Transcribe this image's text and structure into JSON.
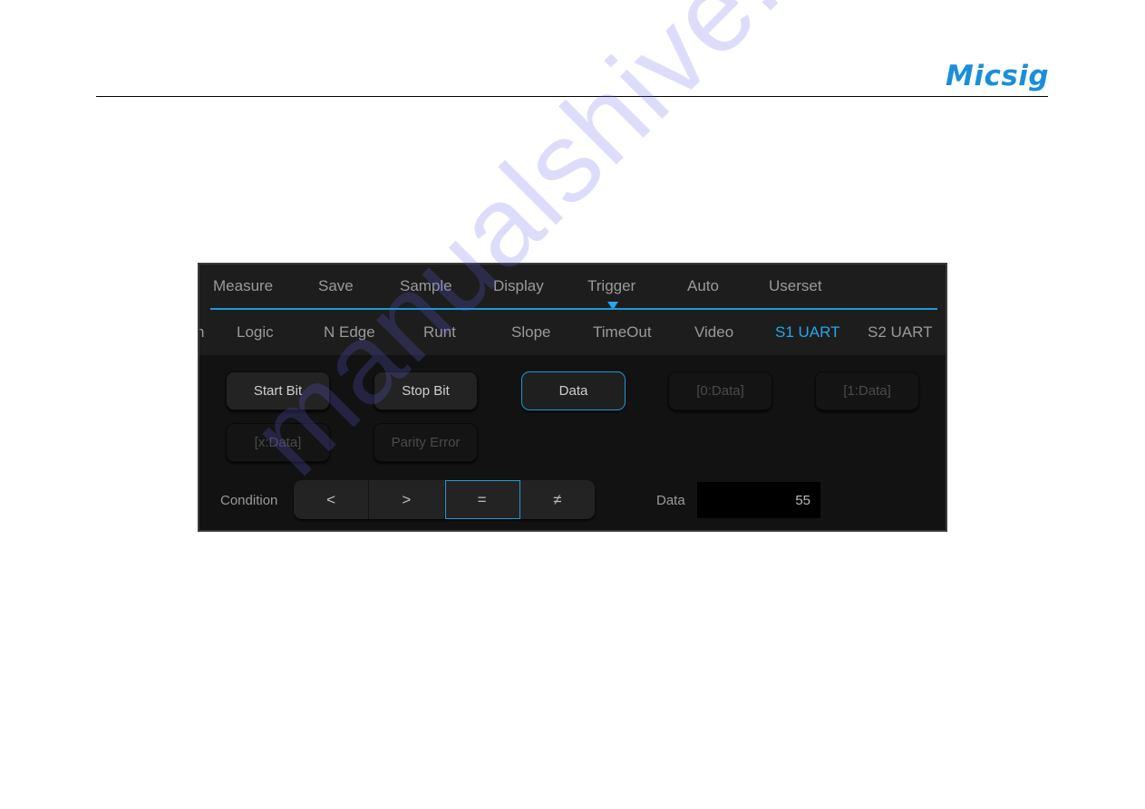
{
  "brand": {
    "logo_text": "Micsig",
    "logo_color": "#1a8fd8"
  },
  "menu": {
    "items": [
      {
        "label": "Measure"
      },
      {
        "label": "Save"
      },
      {
        "label": "Sample"
      },
      {
        "label": "Display"
      },
      {
        "label": "Trigger",
        "active": true
      },
      {
        "label": "Auto"
      },
      {
        "label": "Userset"
      }
    ],
    "accent_color": "#1e9ad6"
  },
  "trigger_types": {
    "partial_left": "n",
    "items": [
      {
        "label": "Logic"
      },
      {
        "label": "N Edge"
      },
      {
        "label": "Runt"
      },
      {
        "label": "Slope"
      },
      {
        "label": "TimeOut"
      },
      {
        "label": "Video"
      },
      {
        "label": "S1 UART",
        "active": true
      },
      {
        "label": "S2 UART"
      }
    ]
  },
  "uart_options": {
    "buttons": [
      {
        "label": "Start Bit",
        "state": "enabled"
      },
      {
        "label": "Stop Bit",
        "state": "enabled"
      },
      {
        "label": "Data",
        "state": "selected"
      },
      {
        "label": "[0:Data]",
        "state": "disabled"
      },
      {
        "label": "[1:Data]",
        "state": "disabled"
      },
      {
        "label": "[x:Data]",
        "state": "disabled"
      },
      {
        "label": "Parity Error",
        "state": "disabled"
      }
    ]
  },
  "condition": {
    "label": "Condition",
    "options": [
      {
        "label": "<"
      },
      {
        "label": ">"
      },
      {
        "label": "=",
        "selected": true
      },
      {
        "label": "≠"
      }
    ]
  },
  "data_input": {
    "label": "Data",
    "value": "55"
  },
  "watermark": {
    "text": "manualshive.com"
  }
}
